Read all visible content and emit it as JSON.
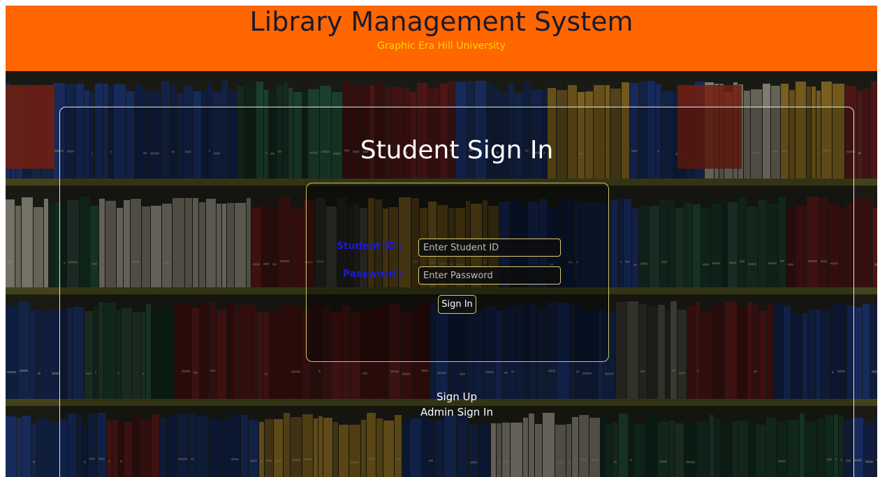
{
  "colors": {
    "header_bg": "#ff6600",
    "subtitle": "#ffd700",
    "label": "#1a1ad8",
    "panel_border": "#e8e8e8",
    "form_border": "#c9c36a"
  },
  "header": {
    "title": "Library Management System",
    "subtitle": "Graphic Era Hill University"
  },
  "panel": {
    "title": "Student Sign In"
  },
  "form": {
    "student_id_label": "Student ID :",
    "student_id_placeholder": "Enter Student ID",
    "student_id_value": "",
    "password_label": "Password :",
    "password_placeholder": "Enter Password",
    "password_value": "",
    "submit_label": "Sign In"
  },
  "links": {
    "sign_up": "Sign Up",
    "admin_sign_in": "Admin Sign In"
  },
  "background": {
    "icon": "bookshelf-photo"
  }
}
